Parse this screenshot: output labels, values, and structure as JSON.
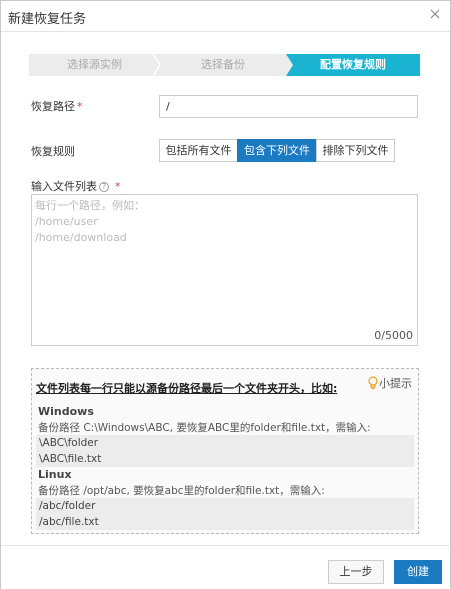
{
  "dialog": {
    "title": "新建恢复任务"
  },
  "steps": [
    {
      "label": "选择源实例",
      "state": "done"
    },
    {
      "label": "选择备份",
      "state": "done"
    },
    {
      "label": "配置恢复规则",
      "state": "active"
    }
  ],
  "form": {
    "path_label": "恢复路径",
    "required_mark": "*",
    "path_value": "/",
    "rule_label": "恢复规则",
    "rule_options": [
      "包括所有文件",
      "包含下列文件",
      "排除下列文件"
    ],
    "rule_selected": "包含下列文件",
    "list_label": "输入文件列表",
    "help_mark": "?",
    "list_placeholder_lines": [
      "每行一个路径，例如：",
      "/home/user",
      "/home/download"
    ],
    "counter": "0/5000"
  },
  "tips": {
    "heading": "文件列表每一行只能以源备份路径最后一个文件夹开头，比如:",
    "hint_label": "小提示",
    "windows": {
      "os": "Windows",
      "desc": "备份路径 C:\\Windows\\ABC, 要恢复ABC里的folder和file.txt，需输入:",
      "lines": [
        "\\ABC\\folder",
        "\\ABC\\file.txt"
      ]
    },
    "linux": {
      "os": "Linux",
      "desc": "备份路径 /opt/abc, 要恢复abc里的folder和file.txt，需输入:",
      "lines": [
        "/abc/folder",
        "/abc/file.txt"
      ]
    }
  },
  "footer": {
    "prev_label": "上一步",
    "create_label": "创建"
  },
  "colors": {
    "primary": "#1a7ac2",
    "step_active": "#1ab3d2",
    "step_inactive": "#ececec",
    "required": "#e4393c"
  }
}
